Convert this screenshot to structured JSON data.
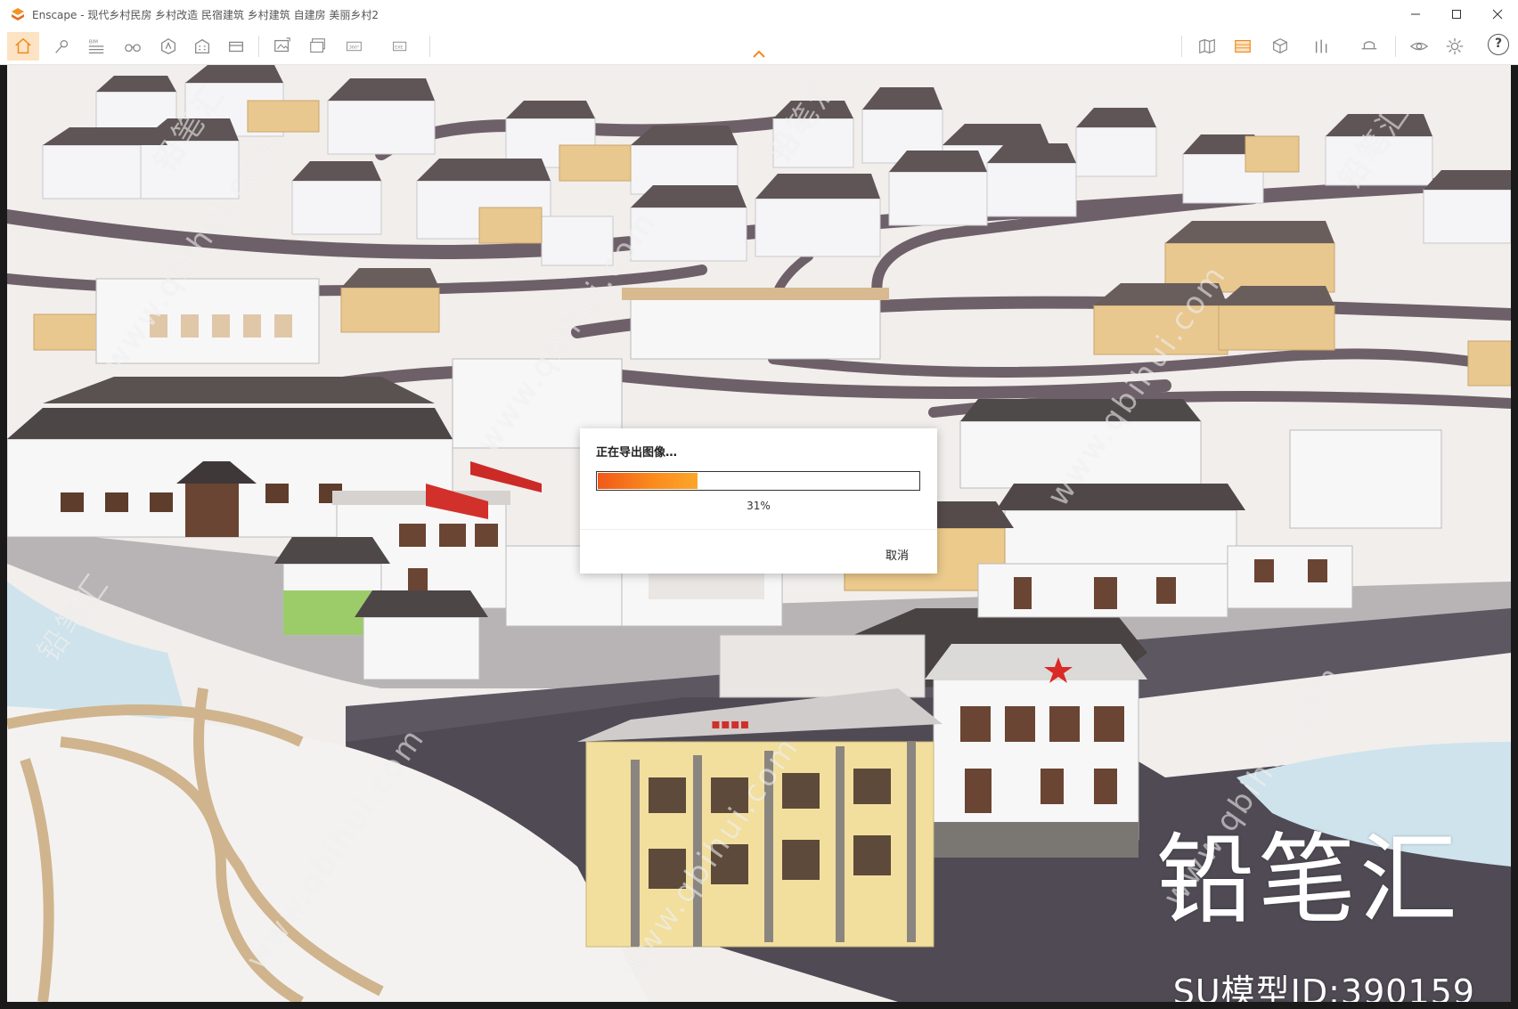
{
  "window": {
    "title": "Enscape - 现代乡村民房 乡村改造 民宿建筑 乡村建筑 自建房 美丽乡村2",
    "controls": [
      "minimize-icon",
      "maximize-icon",
      "close-icon"
    ]
  },
  "toolbar": {
    "left_tools": [
      "home-icon",
      "pin-icon",
      "bim-list-icon",
      "binoculars-icon",
      "asset-icon",
      "building-icon",
      "grid-icon",
      "image-export-icon",
      "batch-export-icon",
      "panorama-360-icon",
      "exe-export-icon"
    ],
    "bim_label": "BIM",
    "pano_label": "360°",
    "exe_label": "EXE",
    "right_tools": [
      "map-icon",
      "material-icon",
      "cube-icon",
      "chart-icon",
      "hat-icon",
      "eye-icon",
      "gear-icon"
    ],
    "help_label": "?",
    "accent": "#f08a1c"
  },
  "export_dialog": {
    "title": "正在导出图像…",
    "progress_percent": 31,
    "progress_label": "31%",
    "cancel_label": "取消"
  },
  "watermark": {
    "brand": "铅笔汇",
    "model_id": "SU模型ID:390159",
    "url": "www.qbihui.com"
  }
}
